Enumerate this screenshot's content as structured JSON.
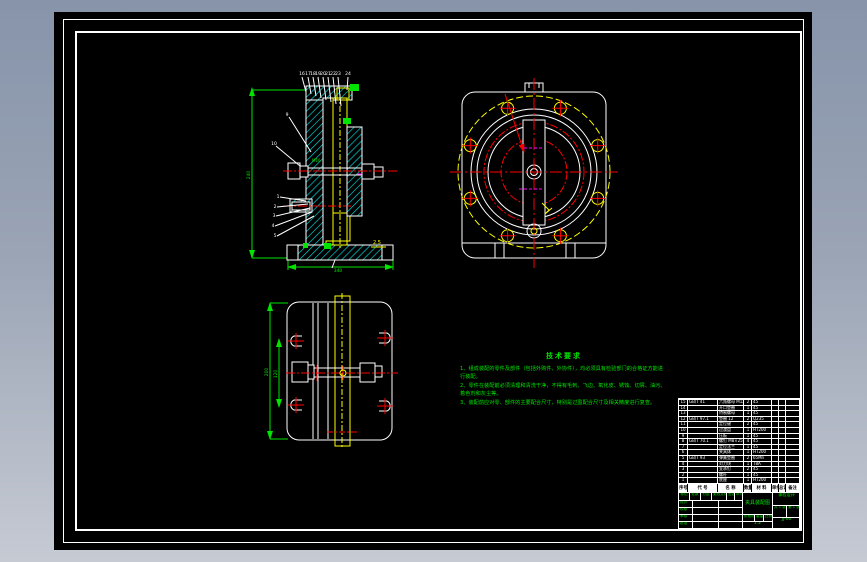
{
  "colors": {
    "backdrop_top": "#8794aa",
    "backdrop_bottom": "#c6cad3",
    "sheet": "#000000",
    "frame": "#ffffff",
    "hatch": "#00dcdc",
    "outline": "#ffffff",
    "part_alt": "#ffff00",
    "centerline": "#ff0000",
    "dimension": "#00e400",
    "detail": "#ff00ff"
  },
  "tech_requirements": {
    "title": "技术要求",
    "items": [
      "1、组成装配的零件及部件（包括外购件、外协件），均必须具有检验部门的合格证方能进行装配。",
      "2、零件在装配前必须清理和清洗干净，不得有毛刺、飞边、氧化皮、锈蚀、切屑、油污、着色剂和灰尘等。",
      "3、装配前应对零、部件的主要配合尺寸，特别是过盈配合尺寸及相关精度进行复查。"
    ]
  },
  "views": {
    "section": {
      "balloons_top": [
        "16",
        "17",
        "18",
        "19",
        "20",
        "21",
        "22",
        "23",
        "24"
      ],
      "balloons_left": [
        "9",
        "10"
      ],
      "balloons_lower": [
        "1",
        "2",
        "3",
        "4",
        "5"
      ],
      "dim_height": "240",
      "dim_width": "340",
      "thread_label": "M16",
      "detail_label": "2.5"
    },
    "bottom": {
      "dim_height": "200",
      "dim_inner": "120"
    }
  },
  "bom": {
    "headers": [
      "序号",
      "代 号",
      "名 称",
      "数量",
      "材 料",
      "单件",
      "总计",
      "备注"
    ],
    "rows": [
      {
        "seq": "1",
        "code": "",
        "name": "底座",
        "qty": "1",
        "mat": "HT200",
        "w1": "",
        "w2": "",
        "note": ""
      },
      {
        "seq": "2",
        "code": "",
        "name": "螺杆",
        "qty": "1",
        "mat": "45",
        "w1": "",
        "w2": "",
        "note": ""
      },
      {
        "seq": "3",
        "code": "",
        "name": "支承钉",
        "qty": "2",
        "mat": "45",
        "w1": "",
        "w2": "",
        "note": ""
      },
      {
        "seq": "4",
        "code": "",
        "name": "对刀块",
        "qty": "1",
        "mat": "T8A",
        "w1": "",
        "w2": "",
        "note": ""
      },
      {
        "seq": "5",
        "code": "GB/T 93",
        "name": "弹簧垫圈",
        "qty": "2",
        "mat": "65Mn",
        "w1": "",
        "w2": "",
        "note": ""
      },
      {
        "seq": "6",
        "code": "",
        "name": "夹具体",
        "qty": "1",
        "mat": "HT200",
        "w1": "",
        "w2": "",
        "note": ""
      },
      {
        "seq": "7",
        "code": "",
        "name": "定位法兰",
        "qty": "1",
        "mat": "45",
        "w1": "",
        "w2": "",
        "note": ""
      },
      {
        "seq": "8",
        "code": "GB/T 70.1",
        "name": "螺钉 M8×25",
        "qty": "4",
        "mat": "45",
        "w1": "",
        "w2": "",
        "note": ""
      },
      {
        "seq": "9",
        "code": "",
        "name": "压板",
        "qty": "1",
        "mat": "45",
        "w1": "",
        "w2": "",
        "note": ""
      },
      {
        "seq": "10",
        "code": "",
        "name": "过渡盘",
        "qty": "1",
        "mat": "HT200",
        "w1": "",
        "w2": "",
        "note": ""
      },
      {
        "seq": "11",
        "code": "",
        "name": "定位键",
        "qty": "2",
        "mat": "45",
        "w1": "",
        "w2": "",
        "note": ""
      },
      {
        "seq": "12",
        "code": "GB/T 97.1",
        "name": "垫圈 12",
        "qty": "2",
        "mat": "Q235",
        "w1": "",
        "w2": "",
        "note": ""
      },
      {
        "seq": "13",
        "code": "",
        "name": "特制螺母",
        "qty": "1",
        "mat": "45",
        "w1": "",
        "w2": "",
        "note": ""
      },
      {
        "seq": "14",
        "code": "",
        "name": "开口垫圈",
        "qty": "1",
        "mat": "45",
        "w1": "",
        "w2": "",
        "note": ""
      },
      {
        "seq": "15",
        "code": "GB/T 41",
        "name": "六角螺母 M12",
        "qty": "2",
        "mat": "45",
        "w1": "",
        "w2": "",
        "note": ""
      }
    ]
  },
  "titleblock": {
    "change_row": [
      "标记",
      "处数",
      "分区",
      "更改文件号",
      "签名",
      "年月日"
    ],
    "sign_labels": [
      "设计",
      "校核",
      "审核",
      "批准"
    ],
    "name": "夹具装配图",
    "stage_label": "阶段标记",
    "weight_label": "重量",
    "scale_label": "比例",
    "scale_value": "1:2",
    "sheets": "共 1 张",
    "sheet_no": "第 1 张",
    "company": "课程设计",
    "drawing_no": "JJ-00"
  }
}
